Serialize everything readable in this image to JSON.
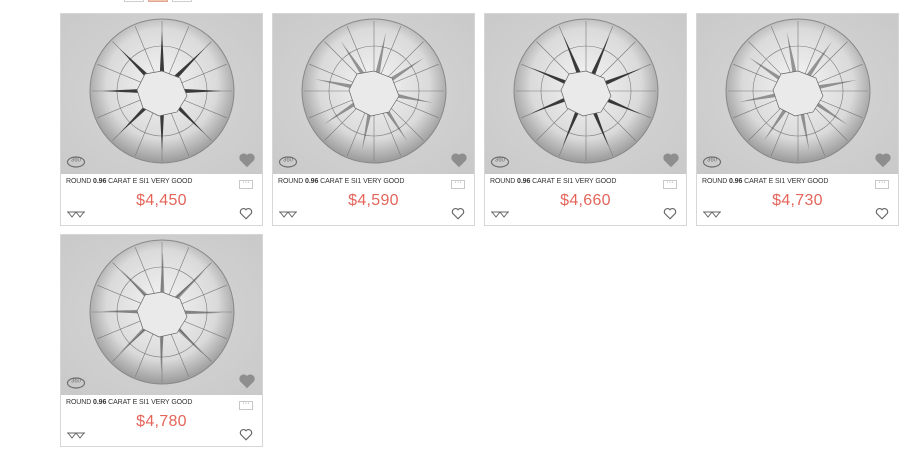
{
  "colors": {
    "price": "#e4655a",
    "border": "#d6d6d6",
    "image_bg": "#cccccc",
    "active_toggle": "#f2c4b2"
  },
  "view_toggle": {
    "options": [
      "grid-small",
      "grid-active",
      "list"
    ]
  },
  "products": [
    {
      "shape": "ROUND",
      "carat": "0.96",
      "carat_label": "CARAT",
      "color_clarity": "E SI1",
      "cut": "VERY GOOD",
      "price": "$4,450",
      "icons": [
        "360-view-icon",
        "heart-icon",
        "compare-icon",
        "more-icon"
      ]
    },
    {
      "shape": "ROUND",
      "carat": "0.96",
      "carat_label": "CARAT",
      "color_clarity": "E SI1",
      "cut": "VERY GOOD",
      "price": "$4,590",
      "icons": [
        "360-view-icon",
        "heart-icon",
        "compare-icon",
        "more-icon"
      ]
    },
    {
      "shape": "ROUND",
      "carat": "0.96",
      "carat_label": "CARAT",
      "color_clarity": "E SI1",
      "cut": "VERY GOOD",
      "price": "$4,660",
      "icons": [
        "360-view-icon",
        "heart-icon",
        "compare-icon",
        "more-icon"
      ]
    },
    {
      "shape": "ROUND",
      "carat": "0.96",
      "carat_label": "CARAT",
      "color_clarity": "E SI1",
      "cut": "VERY GOOD",
      "price": "$4,730",
      "icons": [
        "360-view-icon",
        "heart-icon",
        "compare-icon",
        "more-icon"
      ]
    },
    {
      "shape": "ROUND",
      "carat": "0.96",
      "carat_label": "CARAT",
      "color_clarity": "E SI1",
      "cut": "VERY GOOD",
      "price": "$4,780",
      "icons": [
        "360-view-icon",
        "heart-icon",
        "compare-icon",
        "more-icon"
      ]
    }
  ]
}
